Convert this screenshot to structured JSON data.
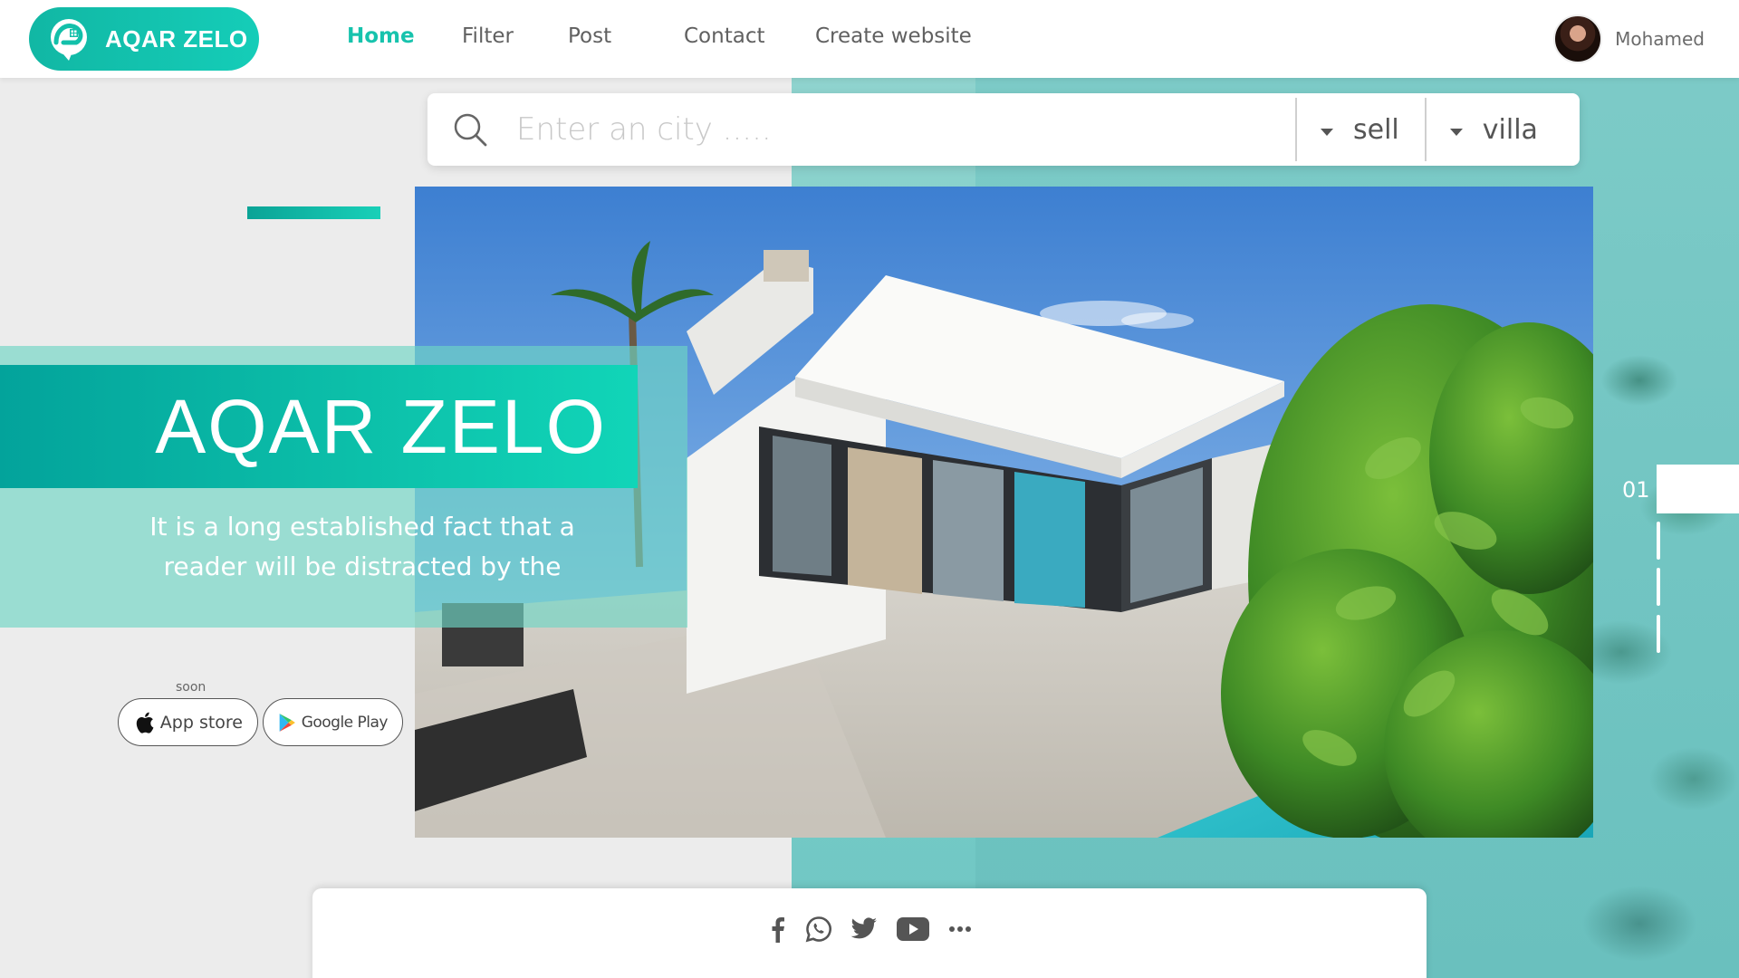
{
  "brand": {
    "name": "AQAR ZELO",
    "accent_color": "#17c3ad"
  },
  "nav": {
    "items": [
      {
        "label": "Home",
        "active": true
      },
      {
        "label": "Filter",
        "active": false
      },
      {
        "label": "Post",
        "active": false
      },
      {
        "label": "Contact",
        "active": false
      },
      {
        "label": "Create website",
        "active": false
      }
    ]
  },
  "user": {
    "name": "Mohamed"
  },
  "search": {
    "placeholder": "Enter an city .....",
    "value": "",
    "type_select": "sell",
    "property_select": "villa"
  },
  "hero": {
    "title": "AQAR ZELO",
    "subtitle": "It is a long established fact that a reader will be distracted by the",
    "slide_number": "01"
  },
  "apps": {
    "soon_label": "soon",
    "app_store_label": "App store",
    "google_play_label": "Google Play"
  },
  "social": {
    "icons": [
      "facebook-icon",
      "whatsapp-icon",
      "twitter-icon",
      "youtube-icon",
      "more-icon"
    ]
  }
}
